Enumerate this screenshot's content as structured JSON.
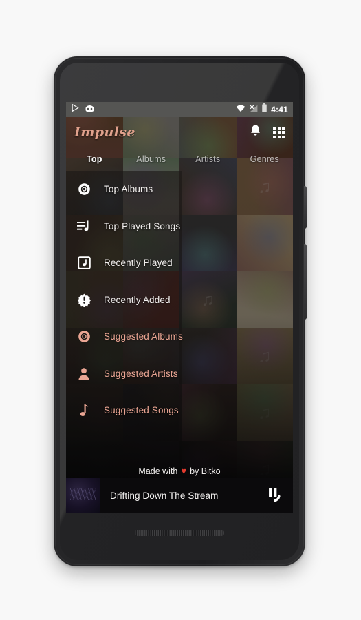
{
  "status_bar": {
    "time": "4:41",
    "left_icons": [
      "play-store-icon",
      "cyanogenmod-icon"
    ],
    "right_icons": [
      "wifi-icon",
      "cellular-no-signal-icon",
      "battery-icon"
    ]
  },
  "app_bar": {
    "logo": "Impulse",
    "actions": [
      {
        "name": "notifications-bell-icon",
        "label": "Notifications"
      },
      {
        "name": "apps-grid-icon",
        "label": "Apps"
      }
    ]
  },
  "tabs": [
    {
      "label": "Top",
      "active": true
    },
    {
      "label": "Albums",
      "active": false
    },
    {
      "label": "Artists",
      "active": false
    },
    {
      "label": "Genres",
      "active": false
    }
  ],
  "menu": [
    {
      "label": "Top Albums",
      "icon": "vinyl-record-icon",
      "accent": false
    },
    {
      "label": "Top Played Songs",
      "icon": "playlist-music-icon",
      "accent": false
    },
    {
      "label": "Recently Played",
      "icon": "music-box-icon",
      "accent": false
    },
    {
      "label": "Recently Added",
      "icon": "new-badge-icon",
      "accent": false
    },
    {
      "label": "Suggested Albums",
      "icon": "vinyl-record-icon",
      "accent": true
    },
    {
      "label": "Suggested Artists",
      "icon": "person-icon",
      "accent": true
    },
    {
      "label": "Suggested Songs",
      "icon": "music-note-icon",
      "accent": true
    }
  ],
  "credit": {
    "prefix": "Made with",
    "heart": "♥",
    "suffix": "by Bitko"
  },
  "now_playing": {
    "title": "Drifting Down The Stream",
    "control": "pause-button",
    "state": "playing"
  },
  "colors": {
    "accent": "#eaa593",
    "logo": "#e0a18c",
    "status_bar_bg": "#555553",
    "heart": "#e23a2e",
    "player_bg": "#0b0a0c",
    "text_primary": "#f2efee"
  },
  "background_tiles": [
    "#6b4a2e",
    "#8d8a84",
    "#7a5a3e",
    "#5e3a28",
    "#3f3a34",
    "#a8a29a",
    "#4a4038",
    "#8a6b4a",
    "#5c4230",
    "#9c9790",
    "#3a3a3c",
    "#b49c74",
    "#7c5a3c",
    "#a6392c",
    "#2f3a30",
    "#c0b49a",
    "#4a3428",
    "#6e4030",
    "#36322e",
    "#8e7a56",
    "#5a4232",
    "#2b2b2d",
    "#40302a",
    "#a08a64",
    "#2a2623",
    "#3a3430",
    "#221f1d",
    "#4e443a",
    "#1e1c1a",
    "#2c2826",
    "#1a1818",
    "#342e2a"
  ]
}
